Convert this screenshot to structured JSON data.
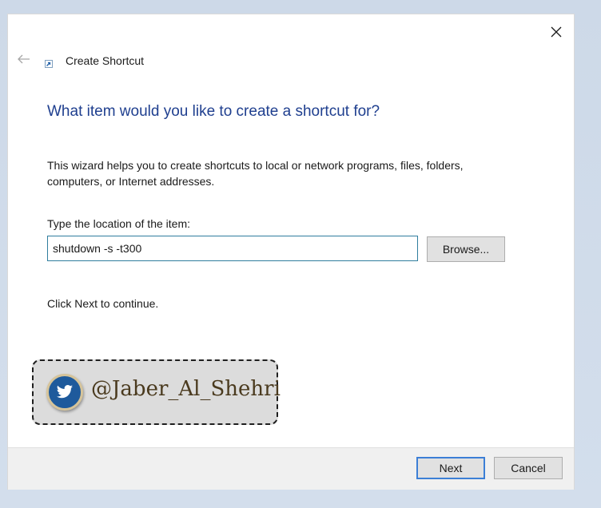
{
  "window": {
    "title": "Create Shortcut"
  },
  "wizard": {
    "heading": "What item would you like to create a shortcut for?",
    "description": "This wizard helps you to create shortcuts to local or network programs, files, folders, computers, or Internet addresses.",
    "location_label": "Type the location of the item:",
    "location_value": "shutdown -s -t300",
    "browse_label": "Browse...",
    "continue_text": "Click Next to continue."
  },
  "footer": {
    "next_label": "Next",
    "cancel_label": "Cancel"
  },
  "badge": {
    "handle": "@Jaber_Al_Shehri",
    "icon": "twitter-bird-icon"
  },
  "colors": {
    "heading": "#1f3f8f",
    "input_border": "#2f7d9e",
    "default_button_border": "#3c7fd6",
    "badge_circle": "#1e5a9c"
  },
  "icons": {
    "close": "close-icon",
    "back": "back-arrow-icon",
    "shortcut": "shortcut-icon"
  }
}
